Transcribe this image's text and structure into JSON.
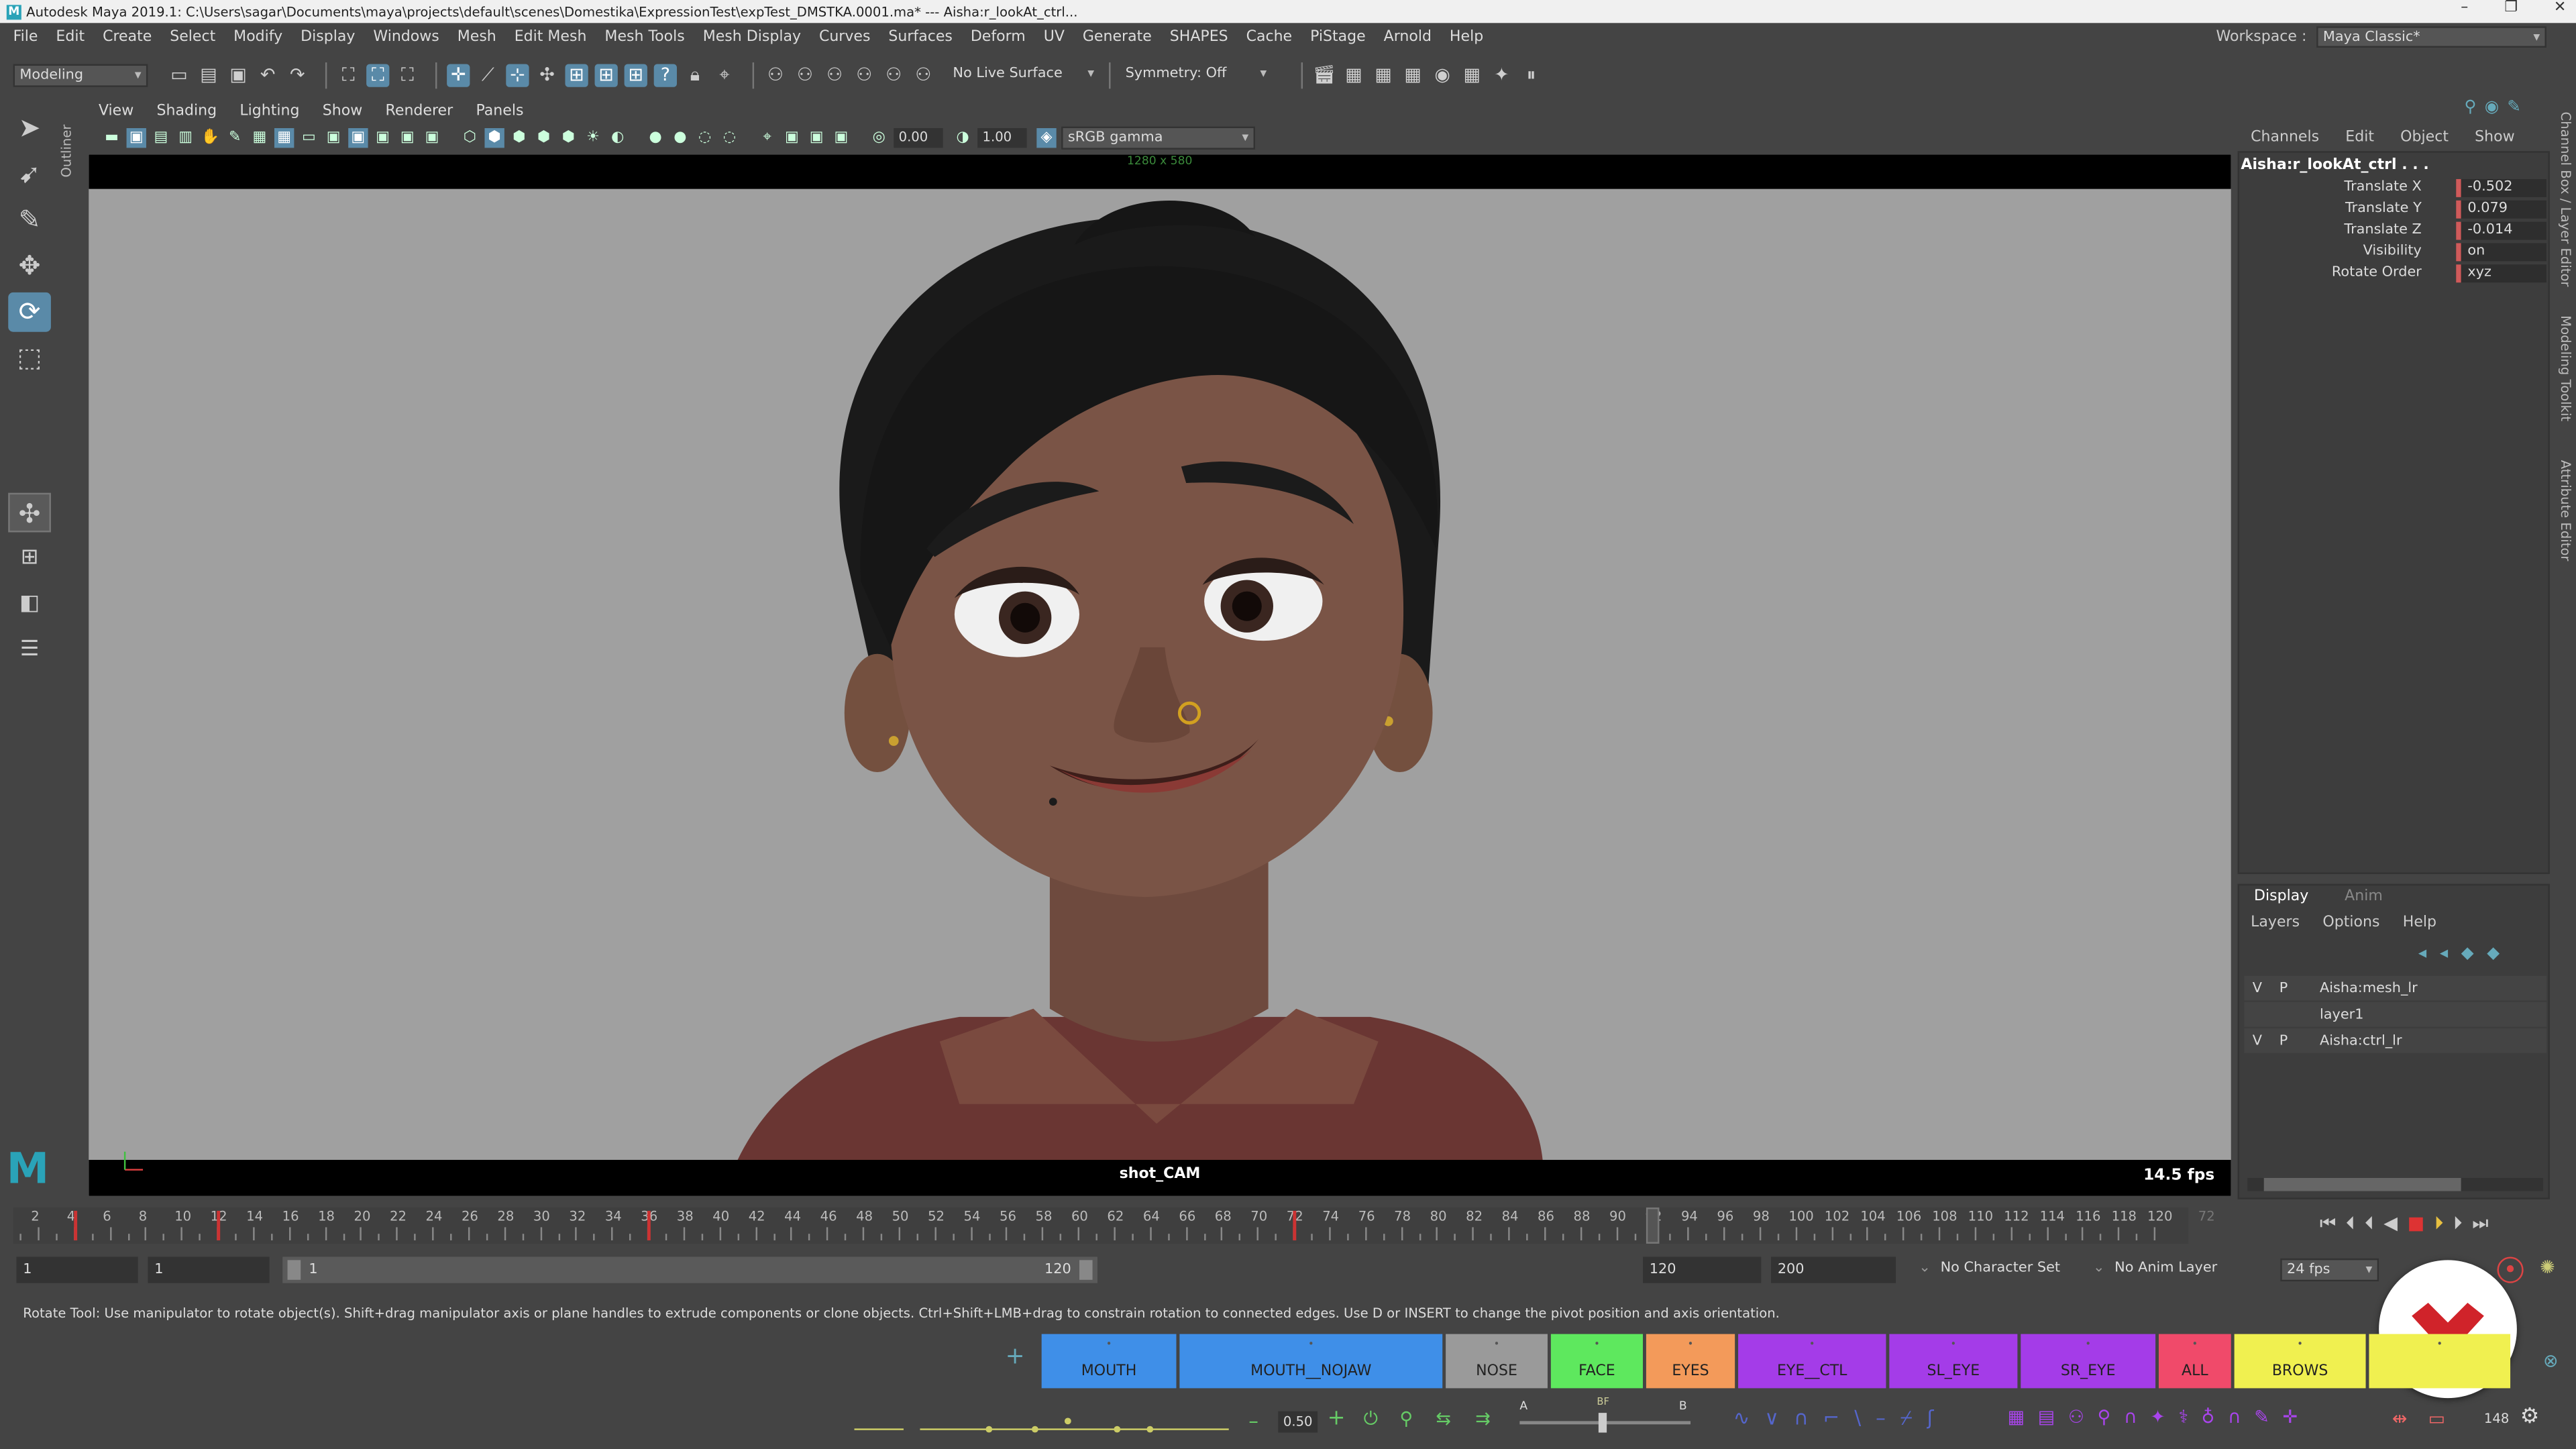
{
  "window": {
    "title": "Autodesk Maya 2019.1: C:\\Users\\sagar\\Documents\\maya\\projects\\default\\scenes\\Domestika\\ExpressionTest\\expTest_DMSTKA.0001.ma*   ---   Aisha:r_lookAt_ctrl..."
  },
  "menubar": [
    "File",
    "Edit",
    "Create",
    "Select",
    "Modify",
    "Display",
    "Windows",
    "Mesh",
    "Edit Mesh",
    "Mesh Tools",
    "Mesh Display",
    "Curves",
    "Surfaces",
    "Deform",
    "UV",
    "Generate",
    "SHAPES",
    "Cache",
    "PiStage",
    "Arnold",
    "Help"
  ],
  "workspace": {
    "label": "Workspace :",
    "value": "Maya Classic*"
  },
  "toolbar": {
    "menuset": "Modeling",
    "live_surface": "No Live Surface",
    "symmetry": "Symmetry: Off"
  },
  "outliner_tab": "Outliner",
  "viewport": {
    "menu": [
      "View",
      "Shading",
      "Lighting",
      "Show",
      "Renderer",
      "Panels"
    ],
    "exposure": "0.00",
    "gamma": "1.00",
    "colorspace": "sRGB gamma",
    "resolution": "1280 x 580",
    "camera": "shot_CAM",
    "fps": "14.5 fps",
    "background": "#a0a0a0"
  },
  "channelbox": {
    "tabs": [
      "Channels",
      "Edit",
      "Object",
      "Show"
    ],
    "node": "Aisha:r_lookAt_ctrl . . .",
    "attributes": [
      {
        "name": "Translate X",
        "value": "-0.502"
      },
      {
        "name": "Translate Y",
        "value": "0.079"
      },
      {
        "name": "Translate Z",
        "value": "-0.014"
      },
      {
        "name": "Visibility",
        "value": "on"
      },
      {
        "name": "Rotate Order",
        "value": "xyz"
      }
    ]
  },
  "side_tabs": [
    "Channel Box / Layer Editor",
    "Modeling Toolkit",
    "Attribute Editor"
  ],
  "layer_editor": {
    "tabs": [
      "Display",
      "Anim"
    ],
    "menu": [
      "Layers",
      "Options",
      "Help"
    ],
    "layers": [
      {
        "v": "V",
        "p": "P",
        "name": "Aisha:mesh_lr"
      },
      {
        "v": "",
        "p": "",
        "name": "layer1"
      },
      {
        "v": "V",
        "p": "P",
        "name": "Aisha:ctrl_lr"
      }
    ]
  },
  "timeline": {
    "ticks": [
      "2",
      "4",
      "6",
      "8",
      "10",
      "12",
      "14",
      "16",
      "18",
      "20",
      "22",
      "24",
      "26",
      "28",
      "30",
      "32",
      "34",
      "36",
      "38",
      "40",
      "42",
      "44",
      "46",
      "48",
      "50",
      "52",
      "54",
      "56",
      "58",
      "60",
      "62",
      "64",
      "66",
      "68",
      "70",
      "72",
      "74",
      "76",
      "78",
      "80",
      "82",
      "84",
      "86",
      "88",
      "90",
      "92",
      "94",
      "96",
      "98",
      "100",
      "102",
      "104",
      "106",
      "108",
      "110",
      "112",
      "114",
      "116",
      "118",
      "120"
    ],
    "current_frame": "92",
    "end_label": "72",
    "key_frames": [
      4,
      12,
      36,
      72,
      92
    ]
  },
  "range": {
    "start": "1",
    "playback_start": "1",
    "range_start": "1",
    "range_end": "120",
    "playback_end": "120",
    "end": "200",
    "character_set": "No Character Set",
    "anim_layer": "No Anim Layer",
    "fps": "24 fps"
  },
  "helpline": "Rotate Tool: Use manipulator to rotate object(s). Shift+drag manipulator axis or plane handles to extrude components or clone objects. Ctrl+Shift+LMB+drag to constrain rotation to connected edges. Use D or INSERT to change the pivot position and axis orientation.",
  "shelf_buttons": [
    {
      "label": "MOUTH",
      "color": "#3f8fe8"
    },
    {
      "label": "MOUTH__NOJAW",
      "color": "#3f8fe8"
    },
    {
      "label": "NOSE",
      "color": "#9a9a9a"
    },
    {
      "label": "FACE",
      "color": "#5ee85e"
    },
    {
      "label": "EYES",
      "color": "#f39a5a"
    },
    {
      "label": "EYE__CTL",
      "color": "#a43ce8"
    },
    {
      "label": "SL_EYE",
      "color": "#a43ce8"
    },
    {
      "label": "SR_EYE",
      "color": "#a43ce8"
    },
    {
      "label": "ALL",
      "color": "#f04a6a"
    },
    {
      "label": "BROWS",
      "color": "#f0f050"
    },
    {
      "label": "",
      "color": "#f0f050"
    }
  ],
  "bottom": {
    "slider_value": "0.50",
    "ab_a": "A",
    "ab_bf": "BF",
    "ab_b": "B",
    "frame_count": "148"
  }
}
